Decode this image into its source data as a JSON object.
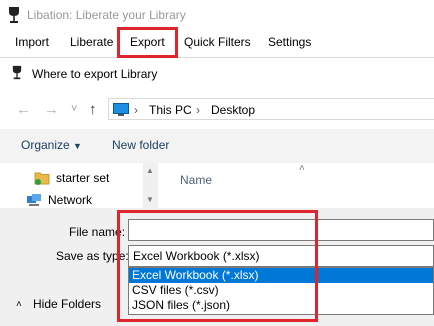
{
  "app": {
    "title": "Libation: Liberate your Library"
  },
  "menu": {
    "items": [
      {
        "label": "Import"
      },
      {
        "label": "Liberate"
      },
      {
        "label": "Export"
      },
      {
        "label": "Quick Filters"
      },
      {
        "label": "Settings"
      }
    ]
  },
  "dialog": {
    "title": "Where to export Library",
    "breadcrumb": [
      "This PC",
      "Desktop"
    ],
    "commands": {
      "organize": "Organize",
      "new_folder": "New folder"
    },
    "nav_items": [
      "starter set",
      "Network"
    ],
    "column_header": "Name",
    "file_name_label": "File name:",
    "file_name_value": "",
    "save_type_label": "Save as type:",
    "save_type_value": "Excel Workbook (*.xlsx)",
    "save_type_options": [
      "Excel Workbook (*.xlsx)",
      "CSV files (*.csv)",
      "JSON files (*.json)"
    ],
    "hide_folders_label": "Hide Folders"
  },
  "colors": {
    "highlight_box": "#e0242b",
    "selection": "#0078d7",
    "folder": "#e8b84a"
  },
  "icons": [
    "wine-glass-icon",
    "arrow-left-icon",
    "arrow-right-icon",
    "arrow-up-icon",
    "monitor-icon",
    "folder-icon",
    "network-icon",
    "caret-down-icon",
    "chevron-up-icon"
  ]
}
